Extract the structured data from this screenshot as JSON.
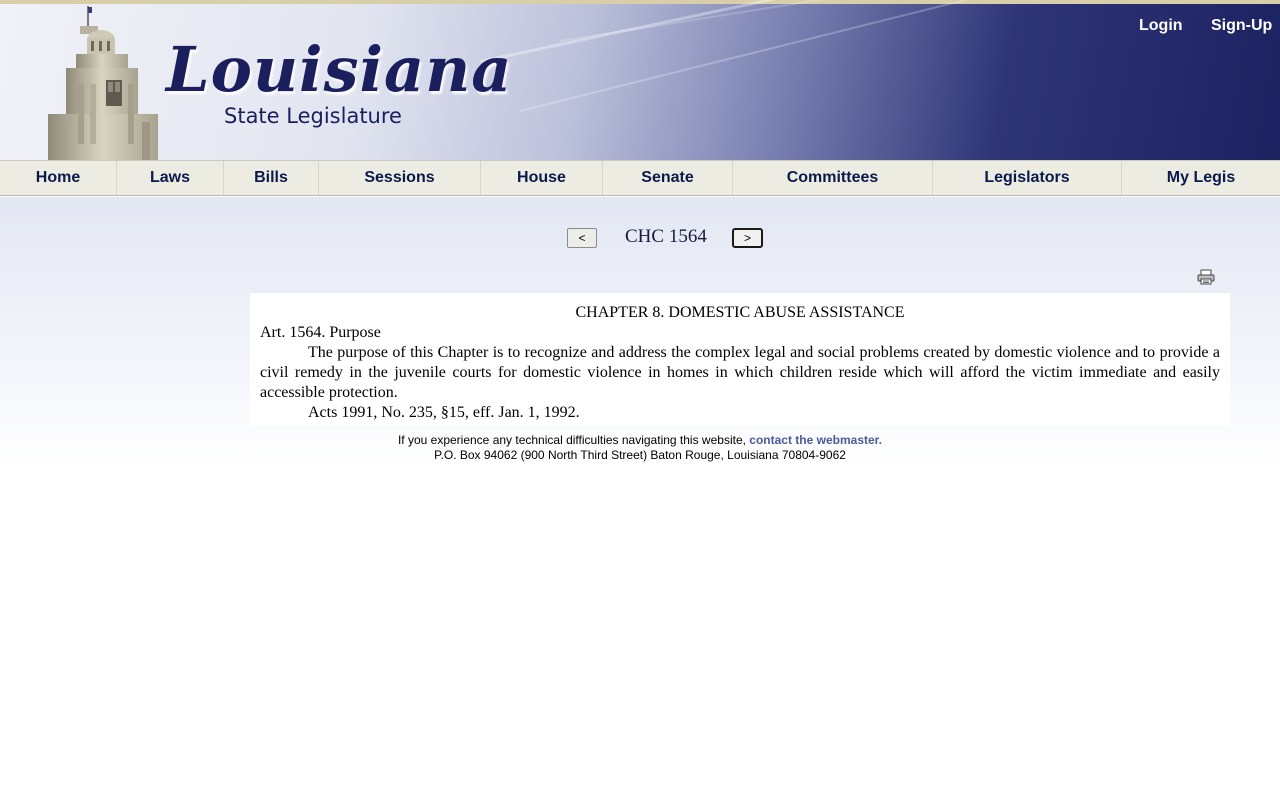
{
  "header": {
    "logo_title": "Louisiana",
    "logo_subtitle": "State Legislature",
    "login_label": "Login",
    "signup_label": "Sign-Up",
    "colors": {
      "banner_dark": "#1c2160",
      "banner_light": "#e2e5f0",
      "link": "#ffffff"
    }
  },
  "nav": {
    "items": [
      {
        "label": "Home"
      },
      {
        "label": "Laws"
      },
      {
        "label": "Bills"
      },
      {
        "label": "Sessions"
      },
      {
        "label": "House"
      },
      {
        "label": "Senate"
      },
      {
        "label": "Committees"
      },
      {
        "label": "Legislators"
      },
      {
        "label": "My Legis"
      }
    ]
  },
  "pager": {
    "prev_label": "<",
    "section_id": "CHC 1564",
    "next_label": ">"
  },
  "icons": {
    "print": "printer-icon"
  },
  "document": {
    "chapter_title": "CHAPTER 8.  DOMESTIC ABUSE ASSISTANCE",
    "article_title": "Art. 1564.  Purpose",
    "article_body": "The purpose of this Chapter is to recognize and address the complex legal and social problems created by domestic violence and to provide a civil remedy in the juvenile courts for domestic violence in homes in which children reside which will afford the victim immediate and easily accessible protection.",
    "history_note": "Acts 1991, No. 235, §15, eff. Jan. 1, 1992."
  },
  "footer": {
    "tech_text": "If you experience any technical difficulties navigating this website,",
    "webmaster_link": "contact the webmaster.",
    "address": "P.O. Box 94062 (900 North Third Street) Baton Rouge, Louisiana 70804-9062",
    "link_color": "#4a5a9a"
  }
}
